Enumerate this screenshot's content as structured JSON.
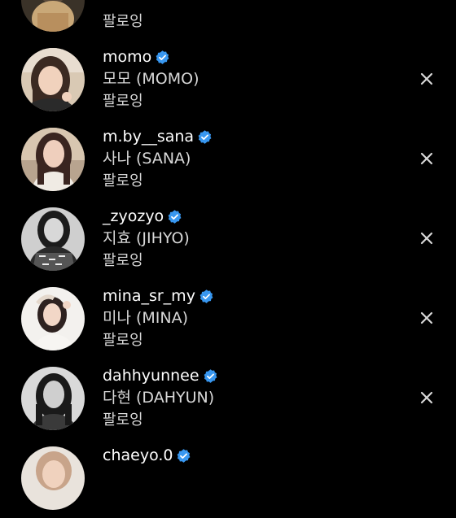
{
  "colors": {
    "background": "#000000",
    "verified_badge": "#3897f0",
    "text_primary": "#ffffff",
    "text_secondary": "#d8d8d8"
  },
  "rows": [
    {
      "username": "",
      "fullname": "",
      "status": "팔로잉",
      "verified": false,
      "avatar_icon": "profile-photo"
    },
    {
      "username": "momo",
      "fullname": "모모 (MOMO)",
      "status": "팔로잉",
      "verified": true,
      "avatar_icon": "profile-photo"
    },
    {
      "username": "m.by__sana",
      "fullname": "사나 (SANA)",
      "status": "팔로잉",
      "verified": true,
      "avatar_icon": "profile-photo"
    },
    {
      "username": "_zyozyo",
      "fullname": "지효 (JIHYO)",
      "status": "팔로잉",
      "verified": true,
      "avatar_icon": "profile-photo"
    },
    {
      "username": "mina_sr_my",
      "fullname": "미나 (MINA)",
      "status": "팔로잉",
      "verified": true,
      "avatar_icon": "profile-photo"
    },
    {
      "username": "dahhyunnee",
      "fullname": "다현 (DAHYUN)",
      "status": "팔로잉",
      "verified": true,
      "avatar_icon": "profile-photo"
    },
    {
      "username": "chaeyo.0",
      "fullname": "",
      "status": "",
      "verified": true,
      "avatar_icon": "profile-photo"
    }
  ],
  "remove_icon": "close-icon"
}
